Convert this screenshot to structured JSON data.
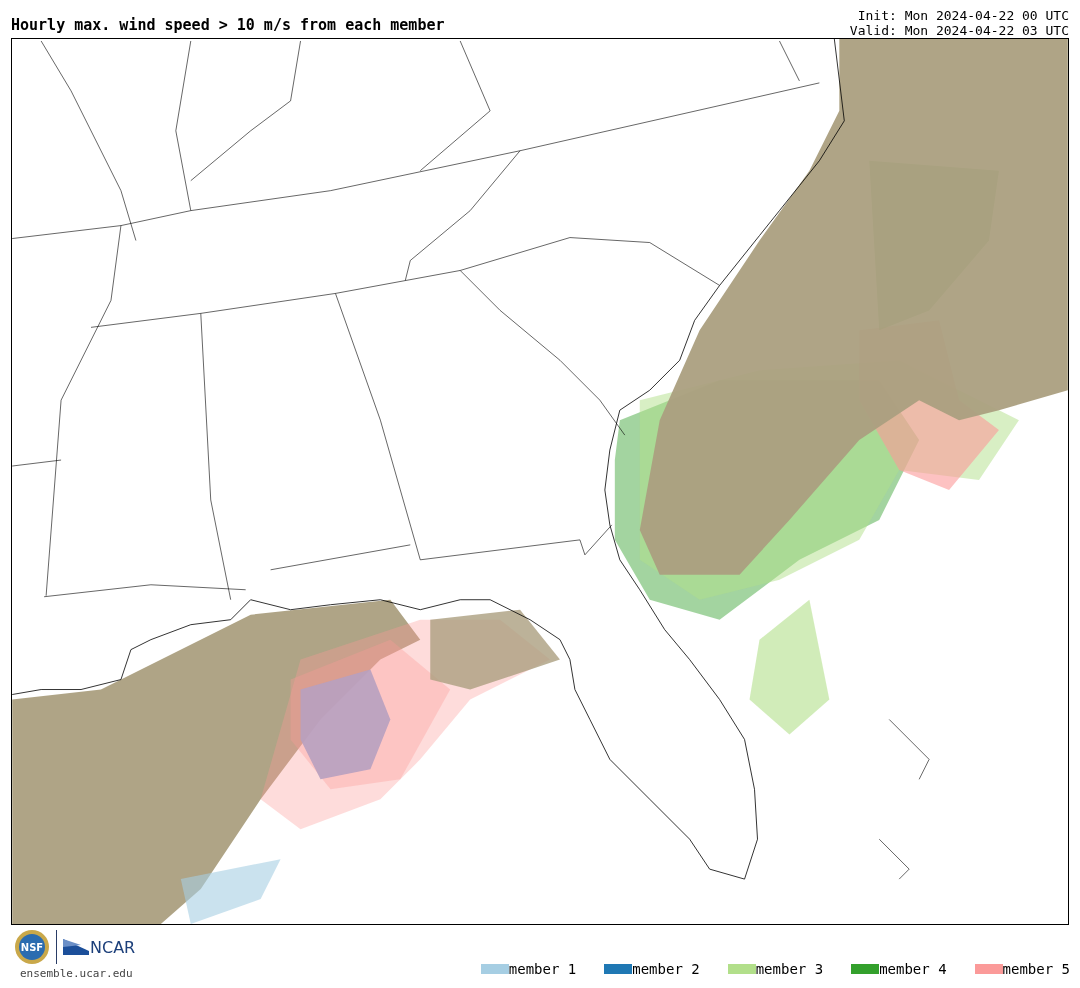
{
  "title": "Hourly max. wind speed > 10 m/s from each member",
  "init": "Init: Mon 2024-04-22 00 UTC",
  "valid": "Valid: Mon 2024-04-22 03 UTC",
  "logos": {
    "nsf": "NSF",
    "ncar": "NCAR"
  },
  "url": "ensemble.ucar.edu",
  "legend": [
    {
      "label": "member 1",
      "color": "#a6cee3"
    },
    {
      "label": "member 2",
      "color": "#1f78b4"
    },
    {
      "label": "member 3",
      "color": "#b2df8a"
    },
    {
      "label": "member 4",
      "color": "#33a02c"
    },
    {
      "label": "member 5",
      "color": "#fb9a99"
    }
  ]
}
